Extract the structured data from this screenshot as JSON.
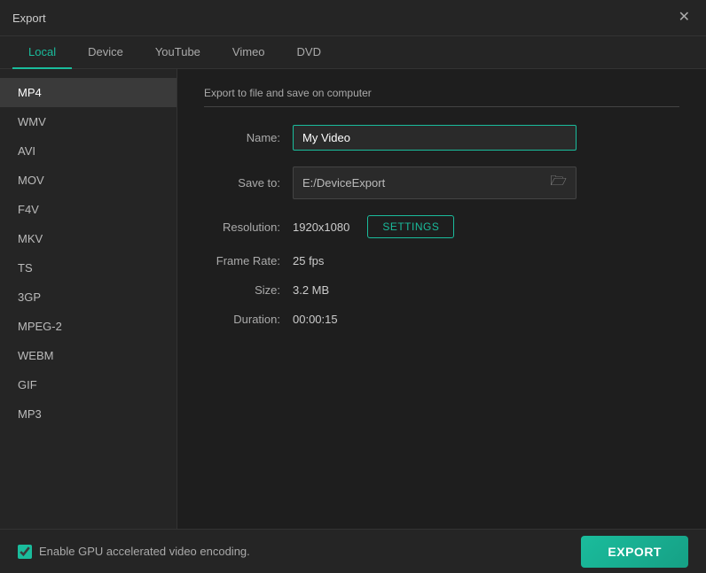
{
  "titleBar": {
    "title": "Export",
    "closeLabel": "✕"
  },
  "tabs": [
    {
      "id": "local",
      "label": "Local",
      "active": true
    },
    {
      "id": "device",
      "label": "Device",
      "active": false
    },
    {
      "id": "youtube",
      "label": "YouTube",
      "active": false
    },
    {
      "id": "vimeo",
      "label": "Vimeo",
      "active": false
    },
    {
      "id": "dvd",
      "label": "DVD",
      "active": false
    }
  ],
  "sidebar": {
    "items": [
      {
        "id": "mp4",
        "label": "MP4",
        "active": true
      },
      {
        "id": "wmv",
        "label": "WMV",
        "active": false
      },
      {
        "id": "avi",
        "label": "AVI",
        "active": false
      },
      {
        "id": "mov",
        "label": "MOV",
        "active": false
      },
      {
        "id": "f4v",
        "label": "F4V",
        "active": false
      },
      {
        "id": "mkv",
        "label": "MKV",
        "active": false
      },
      {
        "id": "ts",
        "label": "TS",
        "active": false
      },
      {
        "id": "3gp",
        "label": "3GP",
        "active": false
      },
      {
        "id": "mpeg2",
        "label": "MPEG-2",
        "active": false
      },
      {
        "id": "webm",
        "label": "WEBM",
        "active": false
      },
      {
        "id": "gif",
        "label": "GIF",
        "active": false
      },
      {
        "id": "mp3",
        "label": "MP3",
        "active": false
      }
    ]
  },
  "content": {
    "sectionTitle": "Export to file and save on computer",
    "nameLabel": "Name:",
    "nameValue": "My Video",
    "saveToLabel": "Save to:",
    "saveToPath": "E:/DeviceExport",
    "resolutionLabel": "Resolution:",
    "resolutionValue": "1920x1080",
    "settingsLabel": "SETTINGS",
    "frameRateLabel": "Frame Rate:",
    "frameRateValue": "25 fps",
    "sizeLabel": "Size:",
    "sizeValue": "3.2 MB",
    "durationLabel": "Duration:",
    "durationValue": "00:00:15"
  },
  "bottomBar": {
    "gpuLabel": "Enable GPU accelerated video encoding.",
    "exportLabel": "EXPORT"
  }
}
